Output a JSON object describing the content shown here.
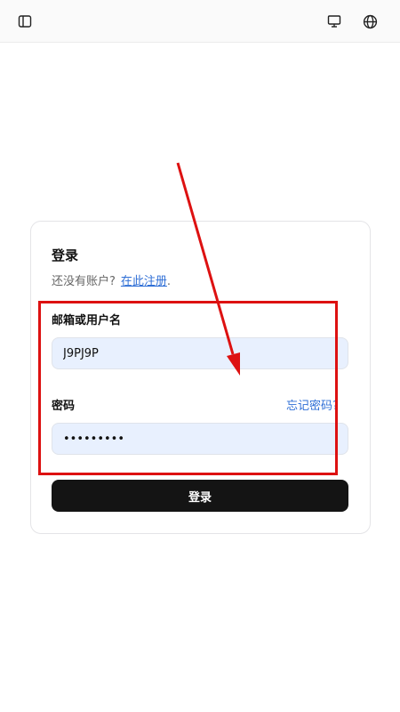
{
  "topbar": {
    "sidebar_icon": "sidebar-toggle-icon",
    "display_icon": "monitor-icon",
    "language_icon": "globe-icon"
  },
  "login": {
    "title": "登录",
    "no_account_text": "还没有账户?",
    "register_link": "在此注册",
    "register_suffix": ".",
    "username_label": "邮箱或用户名",
    "username_value": "J9PJ9P",
    "password_label": "密码",
    "forgot_password": "忘记密码?",
    "password_value": "123456789",
    "submit_label": "登录"
  },
  "annotation": {
    "color": "#dd1111"
  }
}
